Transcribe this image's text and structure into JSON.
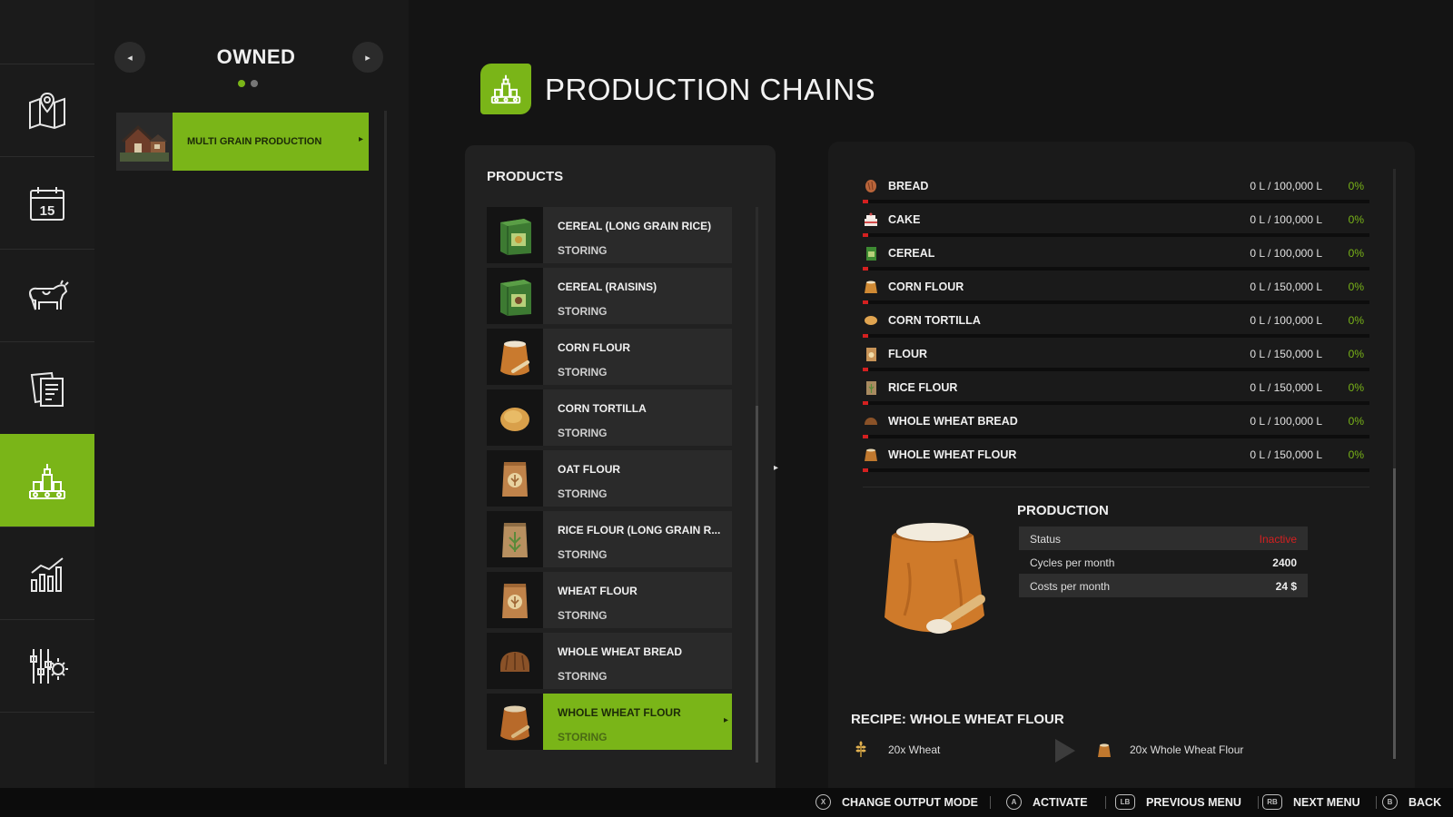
{
  "nav": {
    "items": [
      {
        "icon": "map-icon",
        "active": false
      },
      {
        "icon": "calendar-icon",
        "active": false,
        "calendar_day": "15"
      },
      {
        "icon": "animals-icon",
        "active": false
      },
      {
        "icon": "contracts-icon",
        "active": false
      },
      {
        "icon": "production-icon",
        "active": true
      },
      {
        "icon": "statistics-icon",
        "active": false
      },
      {
        "icon": "settings-icon",
        "active": false
      }
    ]
  },
  "owned": {
    "title": "OWNED",
    "prev_icon": "◂",
    "next_icon": "▸",
    "production_point": "MULTI GRAIN PRODUCTION"
  },
  "header": {
    "title": "PRODUCTION CHAINS"
  },
  "products": {
    "title": "PRODUCTS",
    "items": [
      {
        "name": "CEREAL (LONG GRAIN RICE)",
        "status": "STORING",
        "icon": "cereal-box-icon"
      },
      {
        "name": "CEREAL (RAISINS)",
        "status": "STORING",
        "icon": "cereal-box-icon"
      },
      {
        "name": "CORN FLOUR",
        "status": "STORING",
        "icon": "flour-sack-icon"
      },
      {
        "name": "CORN TORTILLA",
        "status": "STORING",
        "icon": "tortilla-icon"
      },
      {
        "name": "OAT FLOUR",
        "status": "STORING",
        "icon": "flour-bag-icon"
      },
      {
        "name": "RICE FLOUR (LONG GRAIN R...",
        "status": "STORING",
        "icon": "flour-bag-icon"
      },
      {
        "name": "WHEAT FLOUR",
        "status": "STORING",
        "icon": "flour-bag-icon"
      },
      {
        "name": "WHOLE WHEAT BREAD",
        "status": "STORING",
        "icon": "bread-icon"
      },
      {
        "name": "WHOLE WHEAT FLOUR",
        "status": "STORING",
        "icon": "flour-sack-icon",
        "selected": true
      }
    ]
  },
  "storage": {
    "items": [
      {
        "name": "BREAD",
        "amount": "0 L / 100,000 L",
        "percent": "0%",
        "icon": "bread-icon"
      },
      {
        "name": "CAKE",
        "amount": "0 L / 100,000 L",
        "percent": "0%",
        "icon": "cake-icon"
      },
      {
        "name": "CEREAL",
        "amount": "0 L / 100,000 L",
        "percent": "0%",
        "icon": "cereal-box-icon"
      },
      {
        "name": "CORN FLOUR",
        "amount": "0 L / 150,000 L",
        "percent": "0%",
        "icon": "flour-sack-icon"
      },
      {
        "name": "CORN TORTILLA",
        "amount": "0 L / 100,000 L",
        "percent": "0%",
        "icon": "tortilla-icon"
      },
      {
        "name": "FLOUR",
        "amount": "0 L / 150,000 L",
        "percent": "0%",
        "icon": "flour-bag-icon"
      },
      {
        "name": "RICE FLOUR",
        "amount": "0 L / 150,000 L",
        "percent": "0%",
        "icon": "flour-bag-icon"
      },
      {
        "name": "WHOLE WHEAT BREAD",
        "amount": "0 L / 100,000 L",
        "percent": "0%",
        "icon": "bread-icon"
      },
      {
        "name": "WHOLE WHEAT FLOUR",
        "amount": "0 L / 150,000 L",
        "percent": "0%",
        "icon": "flour-sack-icon"
      }
    ]
  },
  "production": {
    "title": "PRODUCTION",
    "status_label": "Status",
    "status_value": "Inactive",
    "cycles_label": "Cycles per month",
    "cycles_value": "2400",
    "costs_label": "Costs per month",
    "costs_value": "24 $"
  },
  "recipe": {
    "title": "RECIPE: WHOLE WHEAT FLOUR",
    "input": "20x Wheat",
    "output": "20x Whole Wheat Flour"
  },
  "footer": {
    "buttons": [
      {
        "key": "X",
        "label": "CHANGE OUTPUT MODE"
      },
      {
        "key": "A",
        "label": "ACTIVATE"
      },
      {
        "key": "LB",
        "label": "PREVIOUS MENU"
      },
      {
        "key": "RB",
        "label": "NEXT MENU"
      },
      {
        "key": "B",
        "label": "BACK"
      }
    ]
  },
  "colors": {
    "accent": "#7ab518",
    "warning": "#d42020",
    "background": "#141414"
  }
}
